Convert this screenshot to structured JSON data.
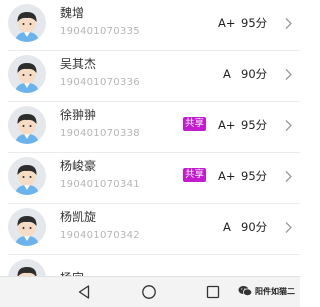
{
  "students": [
    {
      "name": "魏增",
      "id": "190401070335",
      "shared": false,
      "grade": "A+",
      "score": "95分"
    },
    {
      "name": "吴其杰",
      "id": "190401070336",
      "shared": false,
      "grade": "A",
      "score": "90分"
    },
    {
      "name": "徐翀翀",
      "id": "190401070338",
      "shared": true,
      "grade": "A+",
      "score": "95分"
    },
    {
      "name": "杨峻豪",
      "id": "190401070341",
      "shared": true,
      "grade": "A+",
      "score": "95分"
    },
    {
      "name": "杨凯旋",
      "id": "190401070342",
      "shared": false,
      "grade": "A",
      "score": "90分"
    }
  ],
  "shared_label": "共享",
  "partial_row_name": "杨宜",
  "watermark": {
    "text": "阳件如猫二",
    "icon": "wechat-icon"
  },
  "navbar": {
    "back_icon": "back-triangle-icon",
    "home_icon": "home-circle-icon",
    "recent_icon": "recent-square-icon"
  },
  "colors": {
    "badge": "#c21bd0",
    "avatar_bg": "#e4e7eb",
    "student_id": "#b5b5b5"
  }
}
